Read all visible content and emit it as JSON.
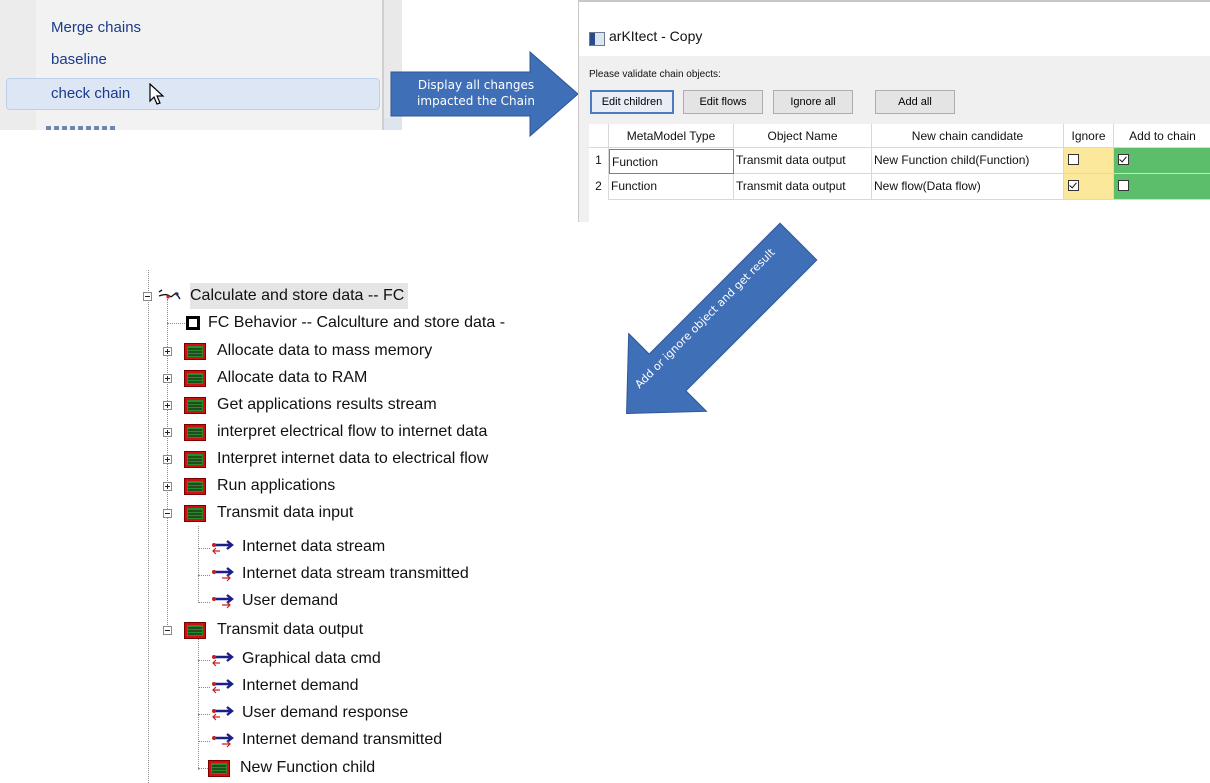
{
  "context_menu": {
    "items": [
      {
        "label": "Merge chains"
      },
      {
        "label": "baseline"
      },
      {
        "label": "check chain"
      }
    ]
  },
  "arrow1": {
    "text": "Display all changes impacted the Chain"
  },
  "arrow2": {
    "text": "Add or ignore object and get result"
  },
  "dialog": {
    "title": "arKItect - Copy",
    "prompt": "Please validate chain objects:",
    "buttons": {
      "edit_children": "Edit children",
      "edit_flows": "Edit flows",
      "ignore_all": "Ignore all",
      "add_all": "Add all"
    },
    "columns": [
      "MetaModel Type",
      "Object Name",
      "New chain candidate",
      "Ignore",
      "Add to chain"
    ],
    "rows": [
      {
        "num": "1",
        "type": "Function",
        "name": "Transmit data output",
        "candidate": "New Function child(Function)",
        "ignore": false,
        "add": true
      },
      {
        "num": "2",
        "type": "Function",
        "name": "Transmit data output",
        "candidate": "New flow(Data flow)",
        "ignore": true,
        "add": false
      }
    ],
    "colors": {
      "ignore": "#fce89a",
      "add": "#5cbd6a"
    }
  },
  "tree": {
    "root": "Calculate and store data -- FC",
    "behavior": "FC Behavior -- Calculture and store data -",
    "functions": [
      "Allocate data to mass memory",
      "Allocate data to RAM",
      "Get applications results stream",
      "interpret electrical flow to internet data",
      "Interpret internet data to electrical flow",
      "Run applications"
    ],
    "transmit_input": {
      "label": "Transmit data input",
      "children": [
        "Internet data stream",
        "Internet data stream transmitted",
        "User demand"
      ]
    },
    "transmit_output": {
      "label": "Transmit data output",
      "children": [
        "Graphical data cmd",
        "Internet demand",
        "User demand response",
        "Internet demand transmitted",
        "New Function child"
      ]
    }
  },
  "colors": {
    "arrow": "#3f6fb6",
    "menu_text": "#1a3a8c"
  }
}
